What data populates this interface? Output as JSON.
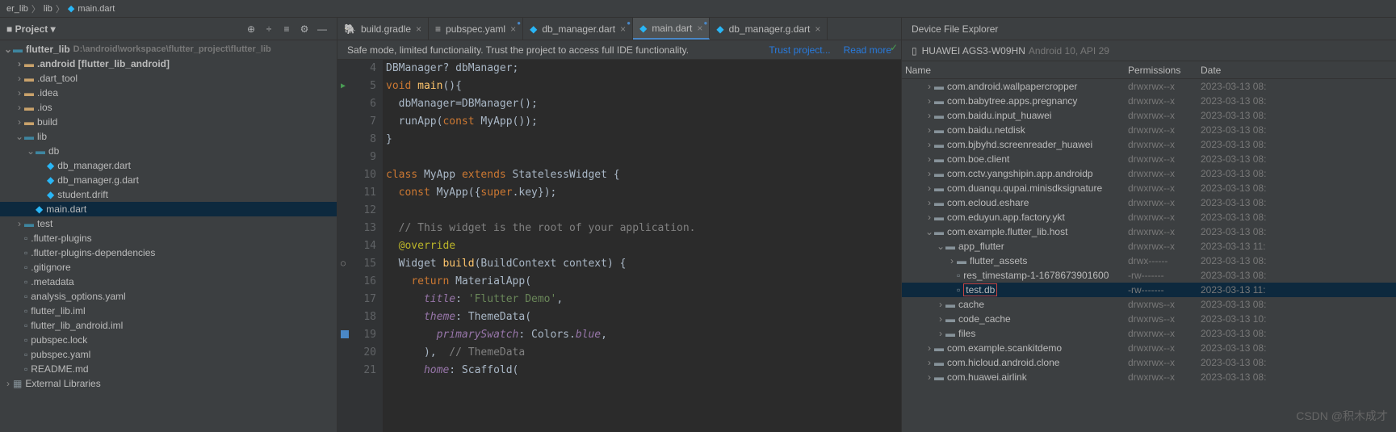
{
  "breadcrumb": [
    "er_lib",
    "lib",
    "main.dart"
  ],
  "project_panel": {
    "title": "Project",
    "root": {
      "name": "flutter_lib",
      "path": "D:\\android\\workspace\\flutter_project\\flutter_lib"
    },
    "items": [
      {
        "depth": 1,
        "chev": "closed",
        "icon": "folder-yellow",
        "label": ".android [flutter_lib_android]",
        "bold": true
      },
      {
        "depth": 1,
        "chev": "closed",
        "icon": "folder-yellow",
        "label": ".dart_tool"
      },
      {
        "depth": 1,
        "chev": "closed",
        "icon": "folder-yellow",
        "label": ".idea"
      },
      {
        "depth": 1,
        "chev": "closed",
        "icon": "folder-yellow",
        "label": ".ios"
      },
      {
        "depth": 1,
        "chev": "closed",
        "icon": "folder-yellow",
        "label": "build"
      },
      {
        "depth": 1,
        "chev": "open",
        "icon": "folder-blue",
        "label": "lib"
      },
      {
        "depth": 2,
        "chev": "open",
        "icon": "folder-blue",
        "label": "db"
      },
      {
        "depth": 3,
        "chev": "",
        "icon": "file-dart",
        "label": "db_manager.dart"
      },
      {
        "depth": 3,
        "chev": "",
        "icon": "file-dart",
        "label": "db_manager.g.dart"
      },
      {
        "depth": 3,
        "chev": "",
        "icon": "file-dart",
        "label": "student.drift"
      },
      {
        "depth": 2,
        "chev": "",
        "icon": "file-dart",
        "label": "main.dart",
        "selected": true
      },
      {
        "depth": 1,
        "chev": "closed",
        "icon": "folder-blue",
        "label": "test"
      },
      {
        "depth": 1,
        "chev": "",
        "icon": "file",
        "label": ".flutter-plugins"
      },
      {
        "depth": 1,
        "chev": "",
        "icon": "file",
        "label": ".flutter-plugins-dependencies"
      },
      {
        "depth": 1,
        "chev": "",
        "icon": "file",
        "label": ".gitignore"
      },
      {
        "depth": 1,
        "chev": "",
        "icon": "file",
        "label": ".metadata"
      },
      {
        "depth": 1,
        "chev": "",
        "icon": "file",
        "label": "analysis_options.yaml"
      },
      {
        "depth": 1,
        "chev": "",
        "icon": "file",
        "label": "flutter_lib.iml"
      },
      {
        "depth": 1,
        "chev": "",
        "icon": "file",
        "label": "flutter_lib_android.iml"
      },
      {
        "depth": 1,
        "chev": "",
        "icon": "file",
        "label": "pubspec.lock"
      },
      {
        "depth": 1,
        "chev": "",
        "icon": "file",
        "label": "pubspec.yaml"
      },
      {
        "depth": 1,
        "chev": "",
        "icon": "file",
        "label": "README.md"
      }
    ],
    "external": "External Libraries"
  },
  "tabs": [
    {
      "icon": "gradle",
      "label": "build.gradle"
    },
    {
      "icon": "yaml",
      "label": "pubspec.yaml",
      "modified": true
    },
    {
      "icon": "dart",
      "label": "db_manager.dart",
      "modified": true
    },
    {
      "icon": "dart",
      "label": "main.dart",
      "active": true,
      "modified": true
    },
    {
      "icon": "dart",
      "label": "db_manager.g.dart"
    }
  ],
  "info_bar": {
    "msg": "Safe mode, limited functionality. Trust the project to access full IDE functionality.",
    "link1": "Trust project...",
    "link2": "Read more"
  },
  "code_lines": [
    {
      "n": 4,
      "html": "DBManager? dbManager;"
    },
    {
      "n": 5,
      "run": true,
      "html": "<span class='kw'>void</span> <span class='fn'>main</span>(){"
    },
    {
      "n": 6,
      "html": "  dbManager=DBManager();"
    },
    {
      "n": 7,
      "html": "  runApp(<span class='kw'>const</span> MyApp());"
    },
    {
      "n": 8,
      "html": "}"
    },
    {
      "n": 9,
      "html": ""
    },
    {
      "n": 10,
      "html": "<span class='kw'>class</span> MyApp <span class='kw'>extends</span> StatelessWidget {"
    },
    {
      "n": 11,
      "html": "  <span class='kw'>const</span> MyApp({<span class='kw'>super</span>.key});"
    },
    {
      "n": 12,
      "html": ""
    },
    {
      "n": 13,
      "html": "  <span class='com'>// This widget is the root of your application.</span>"
    },
    {
      "n": 14,
      "html": "  <span class='ann'>@override</span>"
    },
    {
      "n": 15,
      "marker": "o",
      "html": "  Widget <span class='fn'>build</span>(BuildContext context) {"
    },
    {
      "n": 16,
      "html": "    <span class='kw'>return</span> MaterialApp("
    },
    {
      "n": 17,
      "html": "      <span class='prop'>title</span>: <span class='str'>'Flutter Demo'</span>,"
    },
    {
      "n": 18,
      "html": "      <span class='prop'>theme</span>: ThemeData("
    },
    {
      "n": 19,
      "bp": true,
      "html": "        <span class='prop'>primarySwatch</span>: Colors.<span class='prop'>blue</span>,"
    },
    {
      "n": 20,
      "html": "      ),  <span class='com'>// ThemeData</span>"
    },
    {
      "n": 21,
      "html": "      <span class='prop'>home</span>: Scaffold("
    }
  ],
  "device_panel": {
    "title": "Device File Explorer",
    "device_name": "HUAWEI AGS3-W09HN",
    "device_ver": "Android 10, API 29",
    "cols": {
      "name": "Name",
      "perm": "Permissions",
      "date": "Date"
    },
    "rows": [
      {
        "depth": 2,
        "chev": "closed",
        "icon": "folder",
        "name": "com.android.wallpapercropper",
        "perm": "drwxrwx--x",
        "date": "2023-03-13 08:"
      },
      {
        "depth": 2,
        "chev": "closed",
        "icon": "folder",
        "name": "com.babytree.apps.pregnancy",
        "perm": "drwxrwx--x",
        "date": "2023-03-13 08:"
      },
      {
        "depth": 2,
        "chev": "closed",
        "icon": "folder",
        "name": "com.baidu.input_huawei",
        "perm": "drwxrwx--x",
        "date": "2023-03-13 08:"
      },
      {
        "depth": 2,
        "chev": "closed",
        "icon": "folder",
        "name": "com.baidu.netdisk",
        "perm": "drwxrwx--x",
        "date": "2023-03-13 08:"
      },
      {
        "depth": 2,
        "chev": "closed",
        "icon": "folder",
        "name": "com.bjbyhd.screenreader_huawei",
        "perm": "drwxrwx--x",
        "date": "2023-03-13 08:"
      },
      {
        "depth": 2,
        "chev": "closed",
        "icon": "folder",
        "name": "com.boe.client",
        "perm": "drwxrwx--x",
        "date": "2023-03-13 08:"
      },
      {
        "depth": 2,
        "chev": "closed",
        "icon": "folder",
        "name": "com.cctv.yangshipin.app.androidp",
        "perm": "drwxrwx--x",
        "date": "2023-03-13 08:"
      },
      {
        "depth": 2,
        "chev": "closed",
        "icon": "folder",
        "name": "com.duanqu.qupai.minisdksignature",
        "perm": "drwxrwx--x",
        "date": "2023-03-13 08:"
      },
      {
        "depth": 2,
        "chev": "closed",
        "icon": "folder",
        "name": "com.ecloud.eshare",
        "perm": "drwxrwx--x",
        "date": "2023-03-13 08:"
      },
      {
        "depth": 2,
        "chev": "closed",
        "icon": "folder",
        "name": "com.eduyun.app.factory.ykt",
        "perm": "drwxrwx--x",
        "date": "2023-03-13 08:"
      },
      {
        "depth": 2,
        "chev": "open",
        "icon": "folder",
        "name": "com.example.flutter_lib.host",
        "perm": "drwxrwx--x",
        "date": "2023-03-13 08:"
      },
      {
        "depth": 3,
        "chev": "open",
        "icon": "folder",
        "name": "app_flutter",
        "perm": "drwxrwx--x",
        "date": "2023-03-13 11:"
      },
      {
        "depth": 4,
        "chev": "closed",
        "icon": "folder",
        "name": "flutter_assets",
        "perm": "drwx------",
        "date": "2023-03-13 08:"
      },
      {
        "depth": 4,
        "chev": "",
        "icon": "file",
        "name": "res_timestamp-1-1678673901600",
        "perm": "-rw-------",
        "date": "2023-03-13 08:"
      },
      {
        "depth": 4,
        "chev": "",
        "icon": "file",
        "name": "test.db",
        "perm": "-rw-------",
        "date": "2023-03-13 11:",
        "highlighted": true,
        "boxed": true
      },
      {
        "depth": 3,
        "chev": "closed",
        "icon": "folder",
        "name": "cache",
        "perm": "drwxrws--x",
        "date": "2023-03-13 08:"
      },
      {
        "depth": 3,
        "chev": "closed",
        "icon": "folder",
        "name": "code_cache",
        "perm": "drwxrws--x",
        "date": "2023-03-13 10:"
      },
      {
        "depth": 3,
        "chev": "closed",
        "icon": "folder",
        "name": "files",
        "perm": "drwxrwx--x",
        "date": "2023-03-13 08:"
      },
      {
        "depth": 2,
        "chev": "closed",
        "icon": "folder",
        "name": "com.example.scankitdemo",
        "perm": "drwxrwx--x",
        "date": "2023-03-13 08:"
      },
      {
        "depth": 2,
        "chev": "closed",
        "icon": "folder",
        "name": "com.hicloud.android.clone",
        "perm": "drwxrwx--x",
        "date": "2023-03-13 08:"
      },
      {
        "depth": 2,
        "chev": "closed",
        "icon": "folder",
        "name": "com.huawei.airlink",
        "perm": "drwxrwx--x",
        "date": "2023-03-13 08:"
      }
    ]
  },
  "watermark": "CSDN @积木成才"
}
